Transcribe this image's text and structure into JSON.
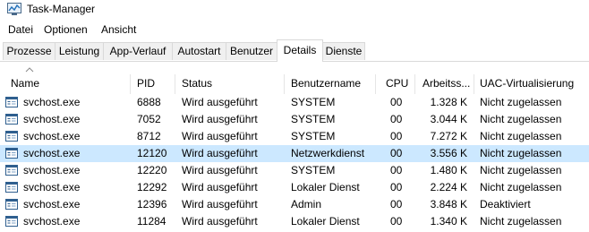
{
  "window": {
    "title": "Task-Manager"
  },
  "menu": [
    "Datei",
    "Optionen",
    "Ansicht"
  ],
  "tabs": [
    "Prozesse",
    "Leistung",
    "App-Verlauf",
    "Autostart",
    "Benutzer",
    "Details",
    "Dienste"
  ],
  "active_tab": "Details",
  "columns": {
    "name": "Name",
    "pid": "PID",
    "status": "Status",
    "user": "Benutzername",
    "cpu": "CPU",
    "mem": "Arbeitss...",
    "uac": "UAC-Virtualisierung"
  },
  "rows": [
    {
      "name": "svchost.exe",
      "pid": "6888",
      "status": "Wird ausgeführt",
      "user": "SYSTEM",
      "cpu": "00",
      "mem": "1.328 K",
      "uac": "Nicht zugelassen"
    },
    {
      "name": "svchost.exe",
      "pid": "7052",
      "status": "Wird ausgeführt",
      "user": "SYSTEM",
      "cpu": "00",
      "mem": "3.044 K",
      "uac": "Nicht zugelassen"
    },
    {
      "name": "svchost.exe",
      "pid": "8712",
      "status": "Wird ausgeführt",
      "user": "SYSTEM",
      "cpu": "00",
      "mem": "7.272 K",
      "uac": "Nicht zugelassen"
    },
    {
      "name": "svchost.exe",
      "pid": "12120",
      "status": "Wird ausgeführt",
      "user": "Netzwerkdienst",
      "cpu": "00",
      "mem": "3.556 K",
      "uac": "Nicht zugelassen",
      "selected": true
    },
    {
      "name": "svchost.exe",
      "pid": "12220",
      "status": "Wird ausgeführt",
      "user": "SYSTEM",
      "cpu": "00",
      "mem": "1.480 K",
      "uac": "Nicht zugelassen"
    },
    {
      "name": "svchost.exe",
      "pid": "12292",
      "status": "Wird ausgeführt",
      "user": "Lokaler Dienst",
      "cpu": "00",
      "mem": "2.224 K",
      "uac": "Nicht zugelassen"
    },
    {
      "name": "svchost.exe",
      "pid": "12396",
      "status": "Wird ausgeführt",
      "user": "Admin",
      "cpu": "00",
      "mem": "3.848 K",
      "uac": "Deaktiviert"
    },
    {
      "name": "svchost.exe",
      "pid": "11284",
      "status": "Wird ausgeführt",
      "user": "Lokaler Dienst",
      "cpu": "00",
      "mem": "1.340 K",
      "uac": "Nicht zugelassen"
    }
  ],
  "colors": {
    "selection": "#cce8ff",
    "border": "#d9d9d9"
  },
  "icons": {
    "app": "task-manager-icon",
    "process": "process-window-icon",
    "sort": "chevron-up-icon"
  }
}
